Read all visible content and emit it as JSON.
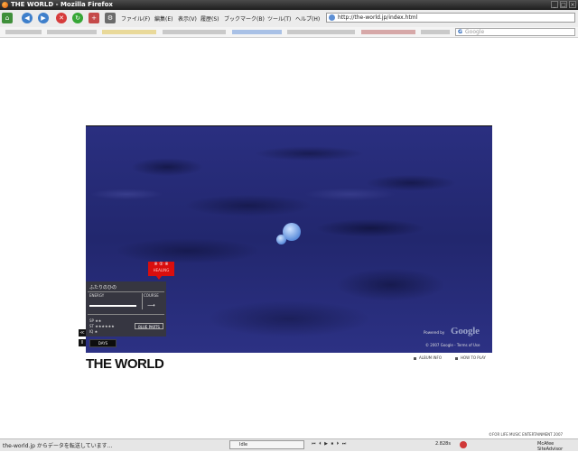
{
  "window": {
    "title": "THE WORLD - Mozilla Firefox"
  },
  "menus": [
    "ファイル(F)",
    "編集(E)",
    "表示(V)",
    "履歴(S)",
    "ブックマーク(B)",
    "ツール(T)",
    "ヘルプ(H)"
  ],
  "address": {
    "url": "http://the-world.jp/index.html"
  },
  "search": {
    "placeholder": "Google"
  },
  "viewer": {
    "tag": {
      "line1": "※ ② ※",
      "line2": "HEALING"
    },
    "panel": {
      "title": "ふたりのひの",
      "energy_label": "ENERGY",
      "course_label": "COURSE",
      "course_arrow": "⟶",
      "stats": [
        "SP ★★",
        "ST ★★★★★★",
        "IQ ★"
      ],
      "button": "BLUE PARTS"
    },
    "days_button": "DAYS",
    "side_buttons": [
      "≪",
      "Ⅱ"
    ],
    "powered_by": "Powered by",
    "google_logo": "Google",
    "copyright": "© 2007 Google - Terms of Use"
  },
  "page": {
    "title": "THE WORLD",
    "links": [
      "ALBUM INFO",
      "HOW TO PLAY"
    ],
    "footer": "©FOR LIFE MUSIC ENTERTAINMENT 2007"
  },
  "status": {
    "text": "the-world.jp からデータを転送しています...",
    "tab": "Idle",
    "icons": "⏮ ⏴ ▶ ⏹ ⏵ ⏭",
    "time": "2.828s",
    "addon": "McAfee SiteAdvisor"
  }
}
